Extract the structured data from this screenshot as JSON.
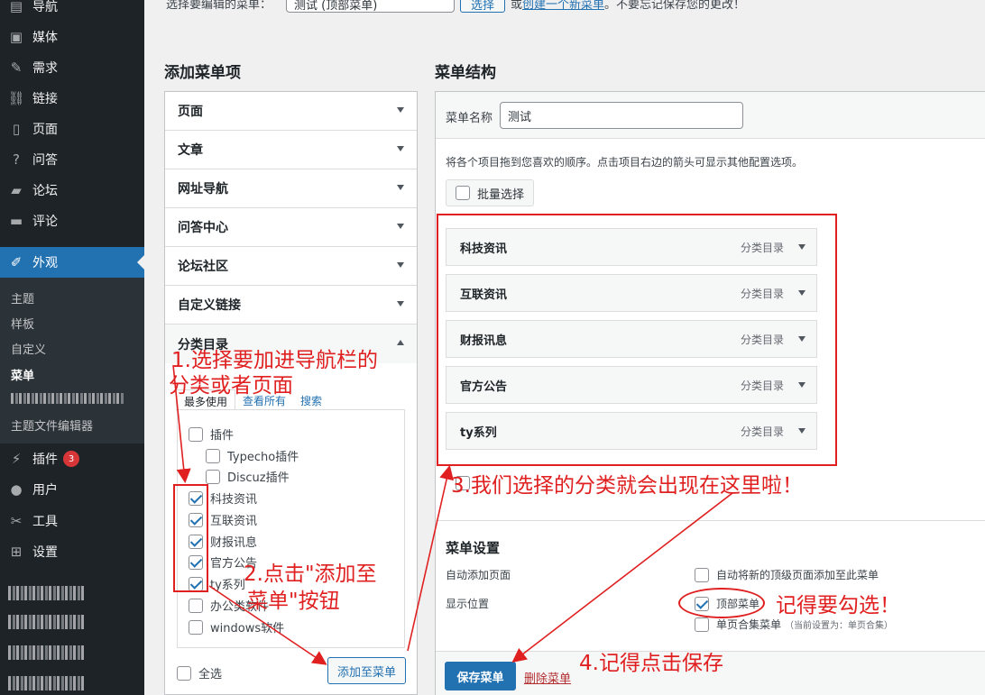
{
  "sidebar": {
    "items": [
      {
        "label": "导航",
        "icon": "navigation-icon"
      },
      {
        "label": "媒体",
        "icon": "media-icon"
      },
      {
        "label": "需求",
        "icon": "edit-icon"
      },
      {
        "label": "链接",
        "icon": "link-icon"
      },
      {
        "label": "页面",
        "icon": "page-icon"
      },
      {
        "label": "问答",
        "icon": "question-icon"
      },
      {
        "label": "论坛",
        "icon": "forum-icon"
      },
      {
        "label": "评论",
        "icon": "comment-icon"
      },
      {
        "label": "外观",
        "icon": "appearance-icon"
      },
      {
        "label": "插件",
        "icon": "plugin-icon",
        "badge": "3"
      },
      {
        "label": "用户",
        "icon": "user-icon"
      },
      {
        "label": "工具",
        "icon": "tool-icon"
      },
      {
        "label": "设置",
        "icon": "settings-icon"
      }
    ],
    "submenu": [
      "主题",
      "样板",
      "自定义",
      "菜单",
      "主题文件编辑器"
    ]
  },
  "top": {
    "select_label": "选择要编辑的菜单：",
    "select_value": "测试 (顶部菜单)",
    "select_button": "选择",
    "create_text_prefix": "或",
    "create_link": "创建一个新菜单",
    "create_text_suffix": "。不要忘记保存您的更改！"
  },
  "left": {
    "title": "添加菜单项",
    "accordions": [
      "页面",
      "文章",
      "网址导航",
      "问答中心",
      "论坛社区",
      "自定义链接",
      "分类目录"
    ],
    "tabs": [
      "最多使用",
      "查看所有",
      "搜索"
    ],
    "categories": [
      {
        "label": "插件",
        "checked": false,
        "level": 0
      },
      {
        "label": "Typecho插件",
        "checked": false,
        "level": 1
      },
      {
        "label": "Discuz插件",
        "checked": false,
        "level": 1
      },
      {
        "label": "科技资讯",
        "checked": true,
        "level": 0
      },
      {
        "label": "互联资讯",
        "checked": true,
        "level": 0
      },
      {
        "label": "财报讯息",
        "checked": true,
        "level": 0
      },
      {
        "label": "官方公告",
        "checked": true,
        "level": 0
      },
      {
        "label": "ty系列",
        "checked": true,
        "level": 0
      },
      {
        "label": "办公类软件",
        "checked": false,
        "level": 0
      },
      {
        "label": "windows软件",
        "checked": false,
        "level": 0
      }
    ],
    "select_all": "全选",
    "add_button": "添加至菜单"
  },
  "right": {
    "title": "菜单结构",
    "name_label": "菜单名称",
    "name_value": "测试",
    "instructions": "将各个项目拖到您喜欢的顺序。点击项目右边的箭头可显示其他配置选项。",
    "bulk_select": "批量选择",
    "menu_items": [
      {
        "label": "科技资讯",
        "type": "分类目录"
      },
      {
        "label": "互联资讯",
        "type": "分类目录"
      },
      {
        "label": "财报讯息",
        "type": "分类目录"
      },
      {
        "label": "官方公告",
        "type": "分类目录"
      },
      {
        "label": "ty系列",
        "type": "分类目录"
      }
    ],
    "settings_title": "菜单设置",
    "auto_add_label": "自动添加页面",
    "auto_add_option": "自动将新的顶级页面添加至此菜单",
    "location_label": "显示位置",
    "locations": [
      {
        "label": "顶部菜单",
        "checked": true,
        "note": ""
      },
      {
        "label": "单页合集菜单",
        "checked": false,
        "note": "（当前设置为：单页合集）"
      }
    ],
    "save_button": "保存菜单",
    "delete_link": "删除菜单"
  },
  "annotations": {
    "step1_line1": "1.选择要加进导航栏的",
    "step1_line2": "分类或者页面",
    "step2_line1": "2.点击\"添加至",
    "step2_line2": "菜单\"按钮",
    "step3": "3.我们选择的分类就会出现在这里啦！",
    "step4": "4.记得点击保存",
    "step5": "记得要勾选！"
  },
  "colors": {
    "accent": "#2271b1",
    "annotation": "#e02020",
    "sidebar": "#1d2327"
  }
}
